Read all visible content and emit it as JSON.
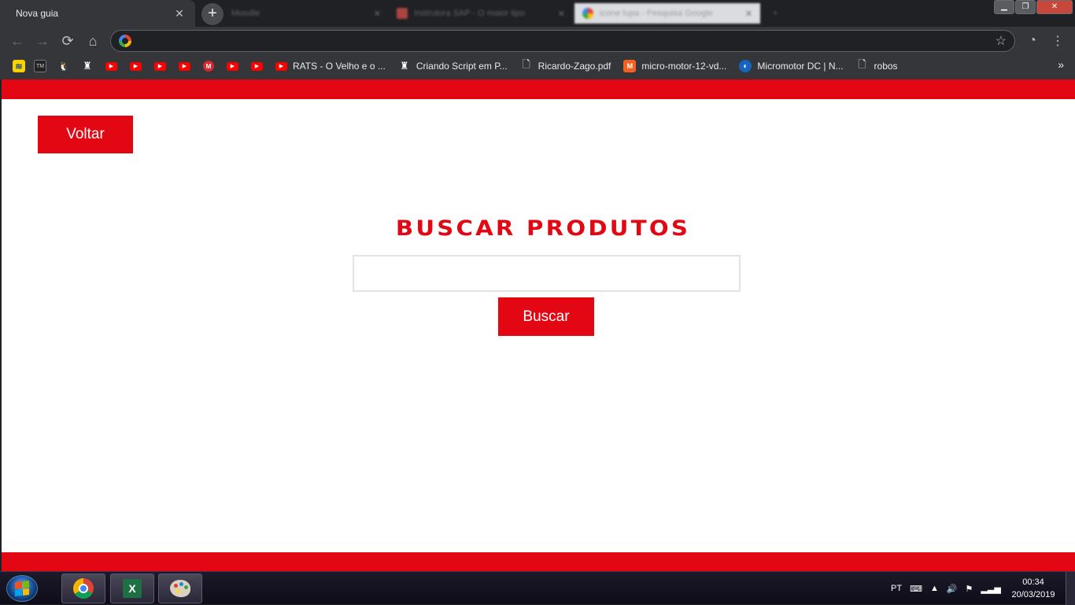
{
  "browser": {
    "active_tab": {
      "title": "Nova guia"
    },
    "background_tabs": [
      {
        "title": "Moodle"
      },
      {
        "title": "Instrutora SAP - O maior tipo"
      },
      {
        "title": "icone lupa - Pesquisa Google"
      }
    ],
    "omnibox": {
      "value": ""
    },
    "bookmarks": [
      {
        "icon": "banco-icon",
        "label": ""
      },
      {
        "icon": "tm-icon",
        "label": ""
      },
      {
        "icon": "penguin-icon",
        "label": ""
      },
      {
        "icon": "spy-icon",
        "label": ""
      },
      {
        "icon": "youtube-icon",
        "label": ""
      },
      {
        "icon": "youtube-icon",
        "label": ""
      },
      {
        "icon": "youtube-icon",
        "label": ""
      },
      {
        "icon": "youtube-icon",
        "label": ""
      },
      {
        "icon": "mega-icon",
        "label": ""
      },
      {
        "icon": "youtube-icon",
        "label": ""
      },
      {
        "icon": "youtube-icon",
        "label": ""
      },
      {
        "icon": "youtube-icon",
        "label": "RATS - O Velho e o ..."
      },
      {
        "icon": "spy-icon",
        "label": "Criando Script em P..."
      },
      {
        "icon": "document-icon",
        "label": "Ricardo-Zago.pdf"
      },
      {
        "icon": "magento-icon",
        "label": "micro-motor-12-vd..."
      },
      {
        "icon": "globe-icon",
        "label": "Micromotor DC | N..."
      },
      {
        "icon": "document-icon",
        "label": "robos"
      }
    ],
    "bookmarks_more": "»"
  },
  "page": {
    "back_button": "Voltar",
    "heading": "BUSCAR PRODUTOS",
    "search": {
      "value": "",
      "placeholder": ""
    },
    "search_button": "Buscar",
    "accent_color": "#e30613"
  },
  "taskbar": {
    "apps": [
      "chrome",
      "excel",
      "paint"
    ],
    "language": "PT",
    "time": "00:34",
    "date": "20/03/2019"
  }
}
